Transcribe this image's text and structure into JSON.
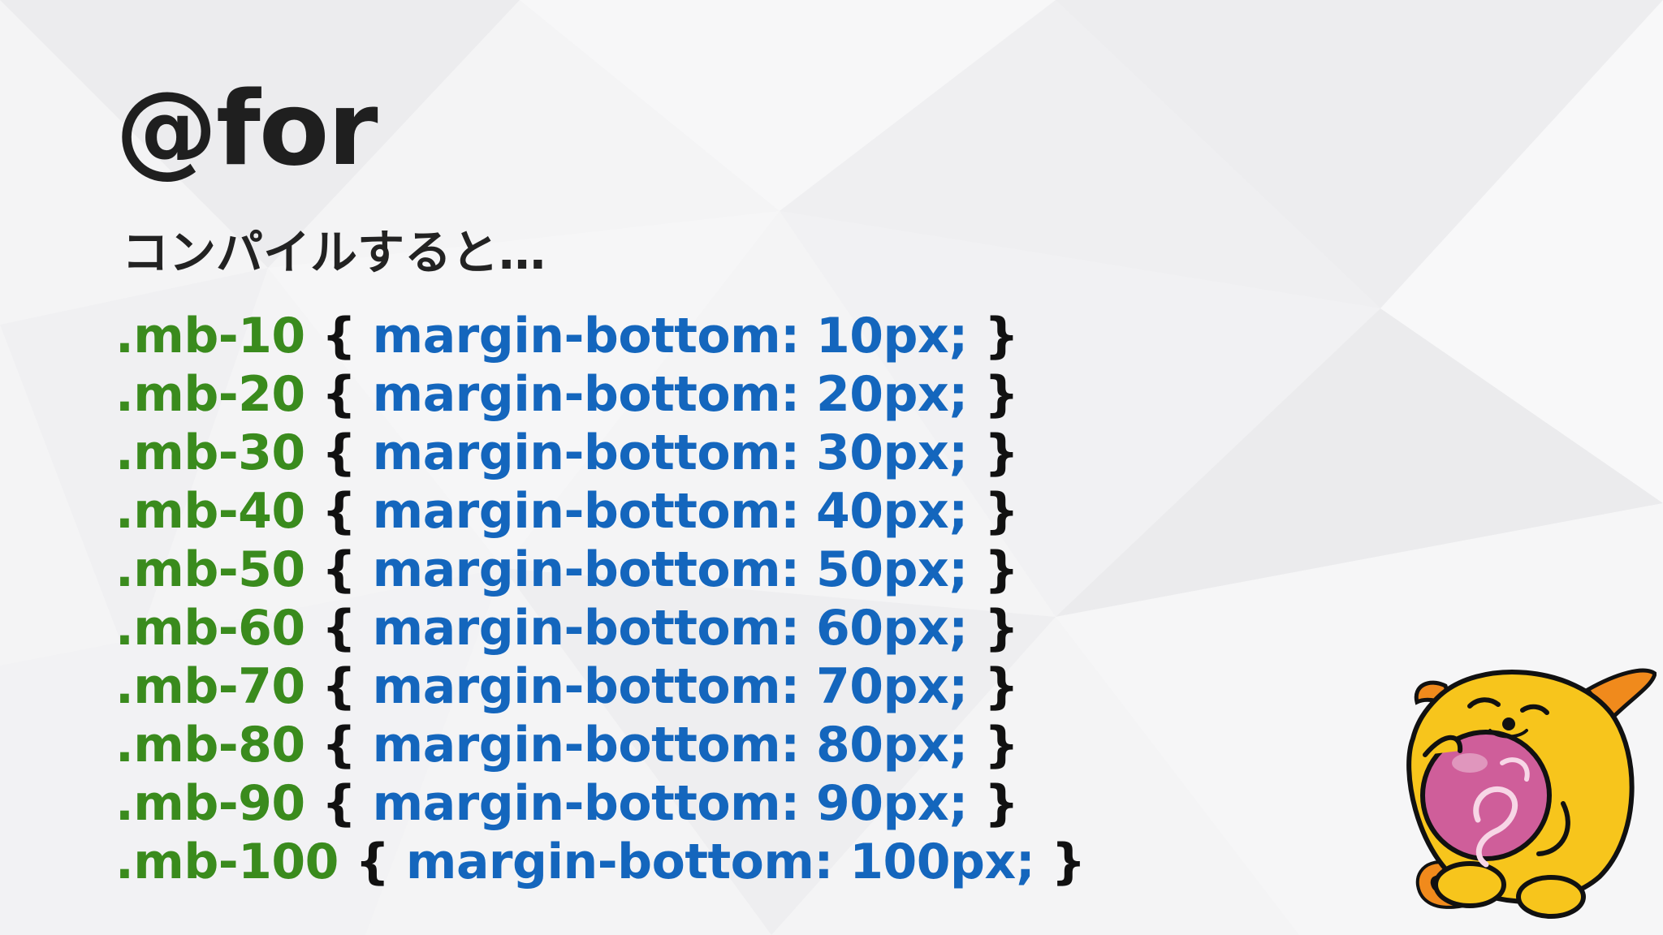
{
  "slide": {
    "title": "@for",
    "subtitle": "コンパイルすると…"
  },
  "code": [
    {
      "selector": ".mb-10",
      "open": "{",
      "declaration": "margin-bottom: 10px;",
      "close": "}"
    },
    {
      "selector": ".mb-20",
      "open": "{",
      "declaration": "margin-bottom: 20px;",
      "close": "}"
    },
    {
      "selector": ".mb-30",
      "open": "{",
      "declaration": "margin-bottom: 30px;",
      "close": "}"
    },
    {
      "selector": ".mb-40",
      "open": "{",
      "declaration": "margin-bottom: 40px;",
      "close": "}"
    },
    {
      "selector": ".mb-50",
      "open": "{",
      "declaration": "margin-bottom: 50px;",
      "close": "}"
    },
    {
      "selector": ".mb-60",
      "open": "{",
      "declaration": "margin-bottom: 60px;",
      "close": "}"
    },
    {
      "selector": ".mb-70",
      "open": "{",
      "declaration": "margin-bottom: 70px;",
      "close": "}"
    },
    {
      "selector": ".mb-80",
      "open": "{",
      "declaration": "margin-bottom: 80px;",
      "close": "}"
    },
    {
      "selector": ".mb-90",
      "open": "{",
      "declaration": "margin-bottom: 90px;",
      "close": "}"
    },
    {
      "selector": ".mb-100",
      "open": "{",
      "declaration": "margin-bottom: 100px;",
      "close": "}"
    }
  ],
  "colors": {
    "background": "#f4f4f5",
    "title": "#1f1f1f",
    "selector": "#3a8b1d",
    "brace": "#111111",
    "property": "#1466bd",
    "mascot_body": "#f7c51c",
    "mascot_ball": "#cf5e9a",
    "mascot_accent": "#f08a1c"
  },
  "icons": {
    "mascot": "wapuu-mascot-icon"
  }
}
